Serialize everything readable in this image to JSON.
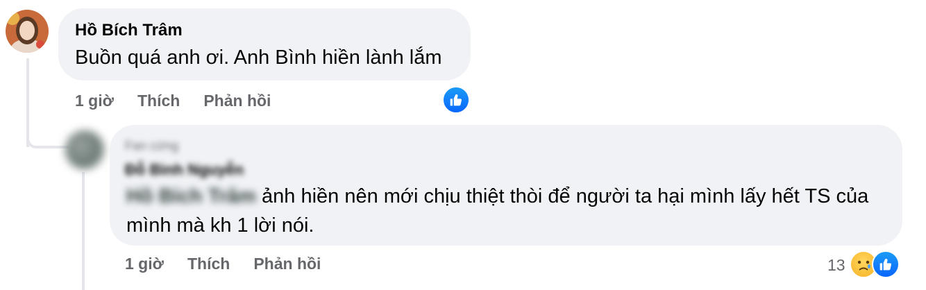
{
  "comment1": {
    "author": "Hồ Bích Trâm",
    "text": "Buồn quá anh ơi. Anh Bình hiền lành lắm",
    "time": "1 giờ",
    "like_label": "Thích",
    "reply_label": "Phản hồi"
  },
  "reply": {
    "top_fan_badge": "Fan cứng",
    "author": "Đỗ Bình Nguyễn",
    "mention": "Hồ Bích Trâm",
    "text": "ảnh hiền nên mới chịu thiệt thòi để người ta hại mình lấy hết TS của mình mà kh 1 lời nói.",
    "time": "1 giờ",
    "like_label": "Thích",
    "reply_label": "Phản hồi",
    "reaction_count": "13"
  },
  "colors": {
    "like_blue": "#0866ff",
    "bubble_bg": "#f0f2f5",
    "meta_gray": "#65676b"
  },
  "icons": {
    "like": "thumbs-up-icon",
    "sad": "sad-face-icon"
  }
}
